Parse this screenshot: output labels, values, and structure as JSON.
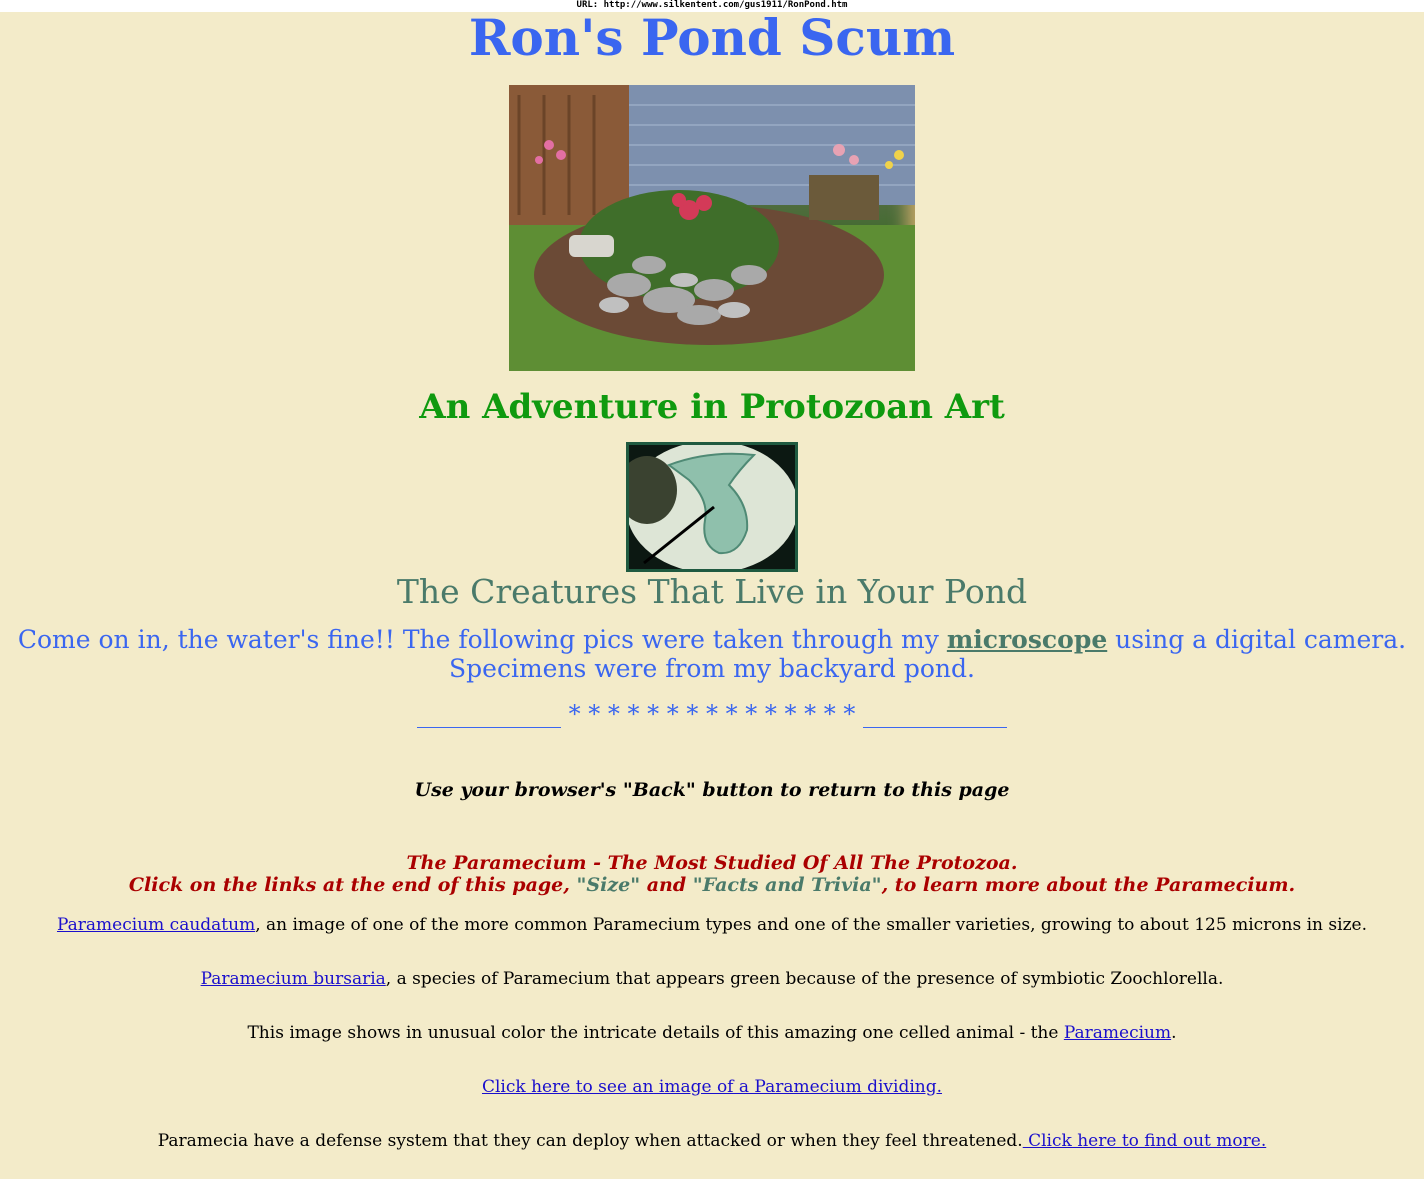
{
  "url_bar": "URL: http://www.silkentent.com/gus1911/RonPond.htm",
  "title": "Ron's Pond Scum",
  "subtitle": "An Adventure in Protozoan Art",
  "creatures_heading": "The Creatures That Live in Your Pond",
  "intro": {
    "before_link": "Come on in, the water's fine!! The following pics were taken through my ",
    "link": "microscope",
    "after_link": " using a digital camera.",
    "line2": "Specimens were from my backyard pond."
  },
  "stars": "* * * * * * * * * * * * * * *",
  "back_notice": "Use your browser's \"Back\" button to return to this page",
  "paramecium_heading": {
    "line1": "The Paramecium - The Most Studied Of All The Protozoa.",
    "line2_a": "Click on the links at the end of this page, ",
    "size": "\"Size\"",
    "and": " and ",
    "facts": "\"Facts and Trivia\"",
    "line2_b": ", to learn more about the Paramecium."
  },
  "items": {
    "caudatum_link": "Paramecium caudatum",
    "caudatum_text": ", an image of one of the more common Paramecium types and one of the smaller varieties, growing to about 125 microns in size.",
    "bursaria_link": "Paramecium bursaria",
    "bursaria_text": ", a species of Paramecium that appears green because of the presence of symbiotic Zoochlorella.",
    "color_text": "This image shows in unusual color the intricate details of this amazing one celled animal - the ",
    "color_link": "Paramecium",
    "color_end": ".",
    "dividing_link": "Click here to see an image of a Paramecium dividing.",
    "defense_text": "Paramecia have a defense system that they can deploy when attacked or when they feel threatened.",
    "defense_link": " Click here to find out more."
  },
  "colors": {
    "background": "#f3ebc9",
    "title_blue": "#3a66f0",
    "subtitle_green": "#0f9a0f",
    "teal": "#4a7a6a",
    "dark_red": "#aa0000",
    "link": "#1a0fcc"
  }
}
